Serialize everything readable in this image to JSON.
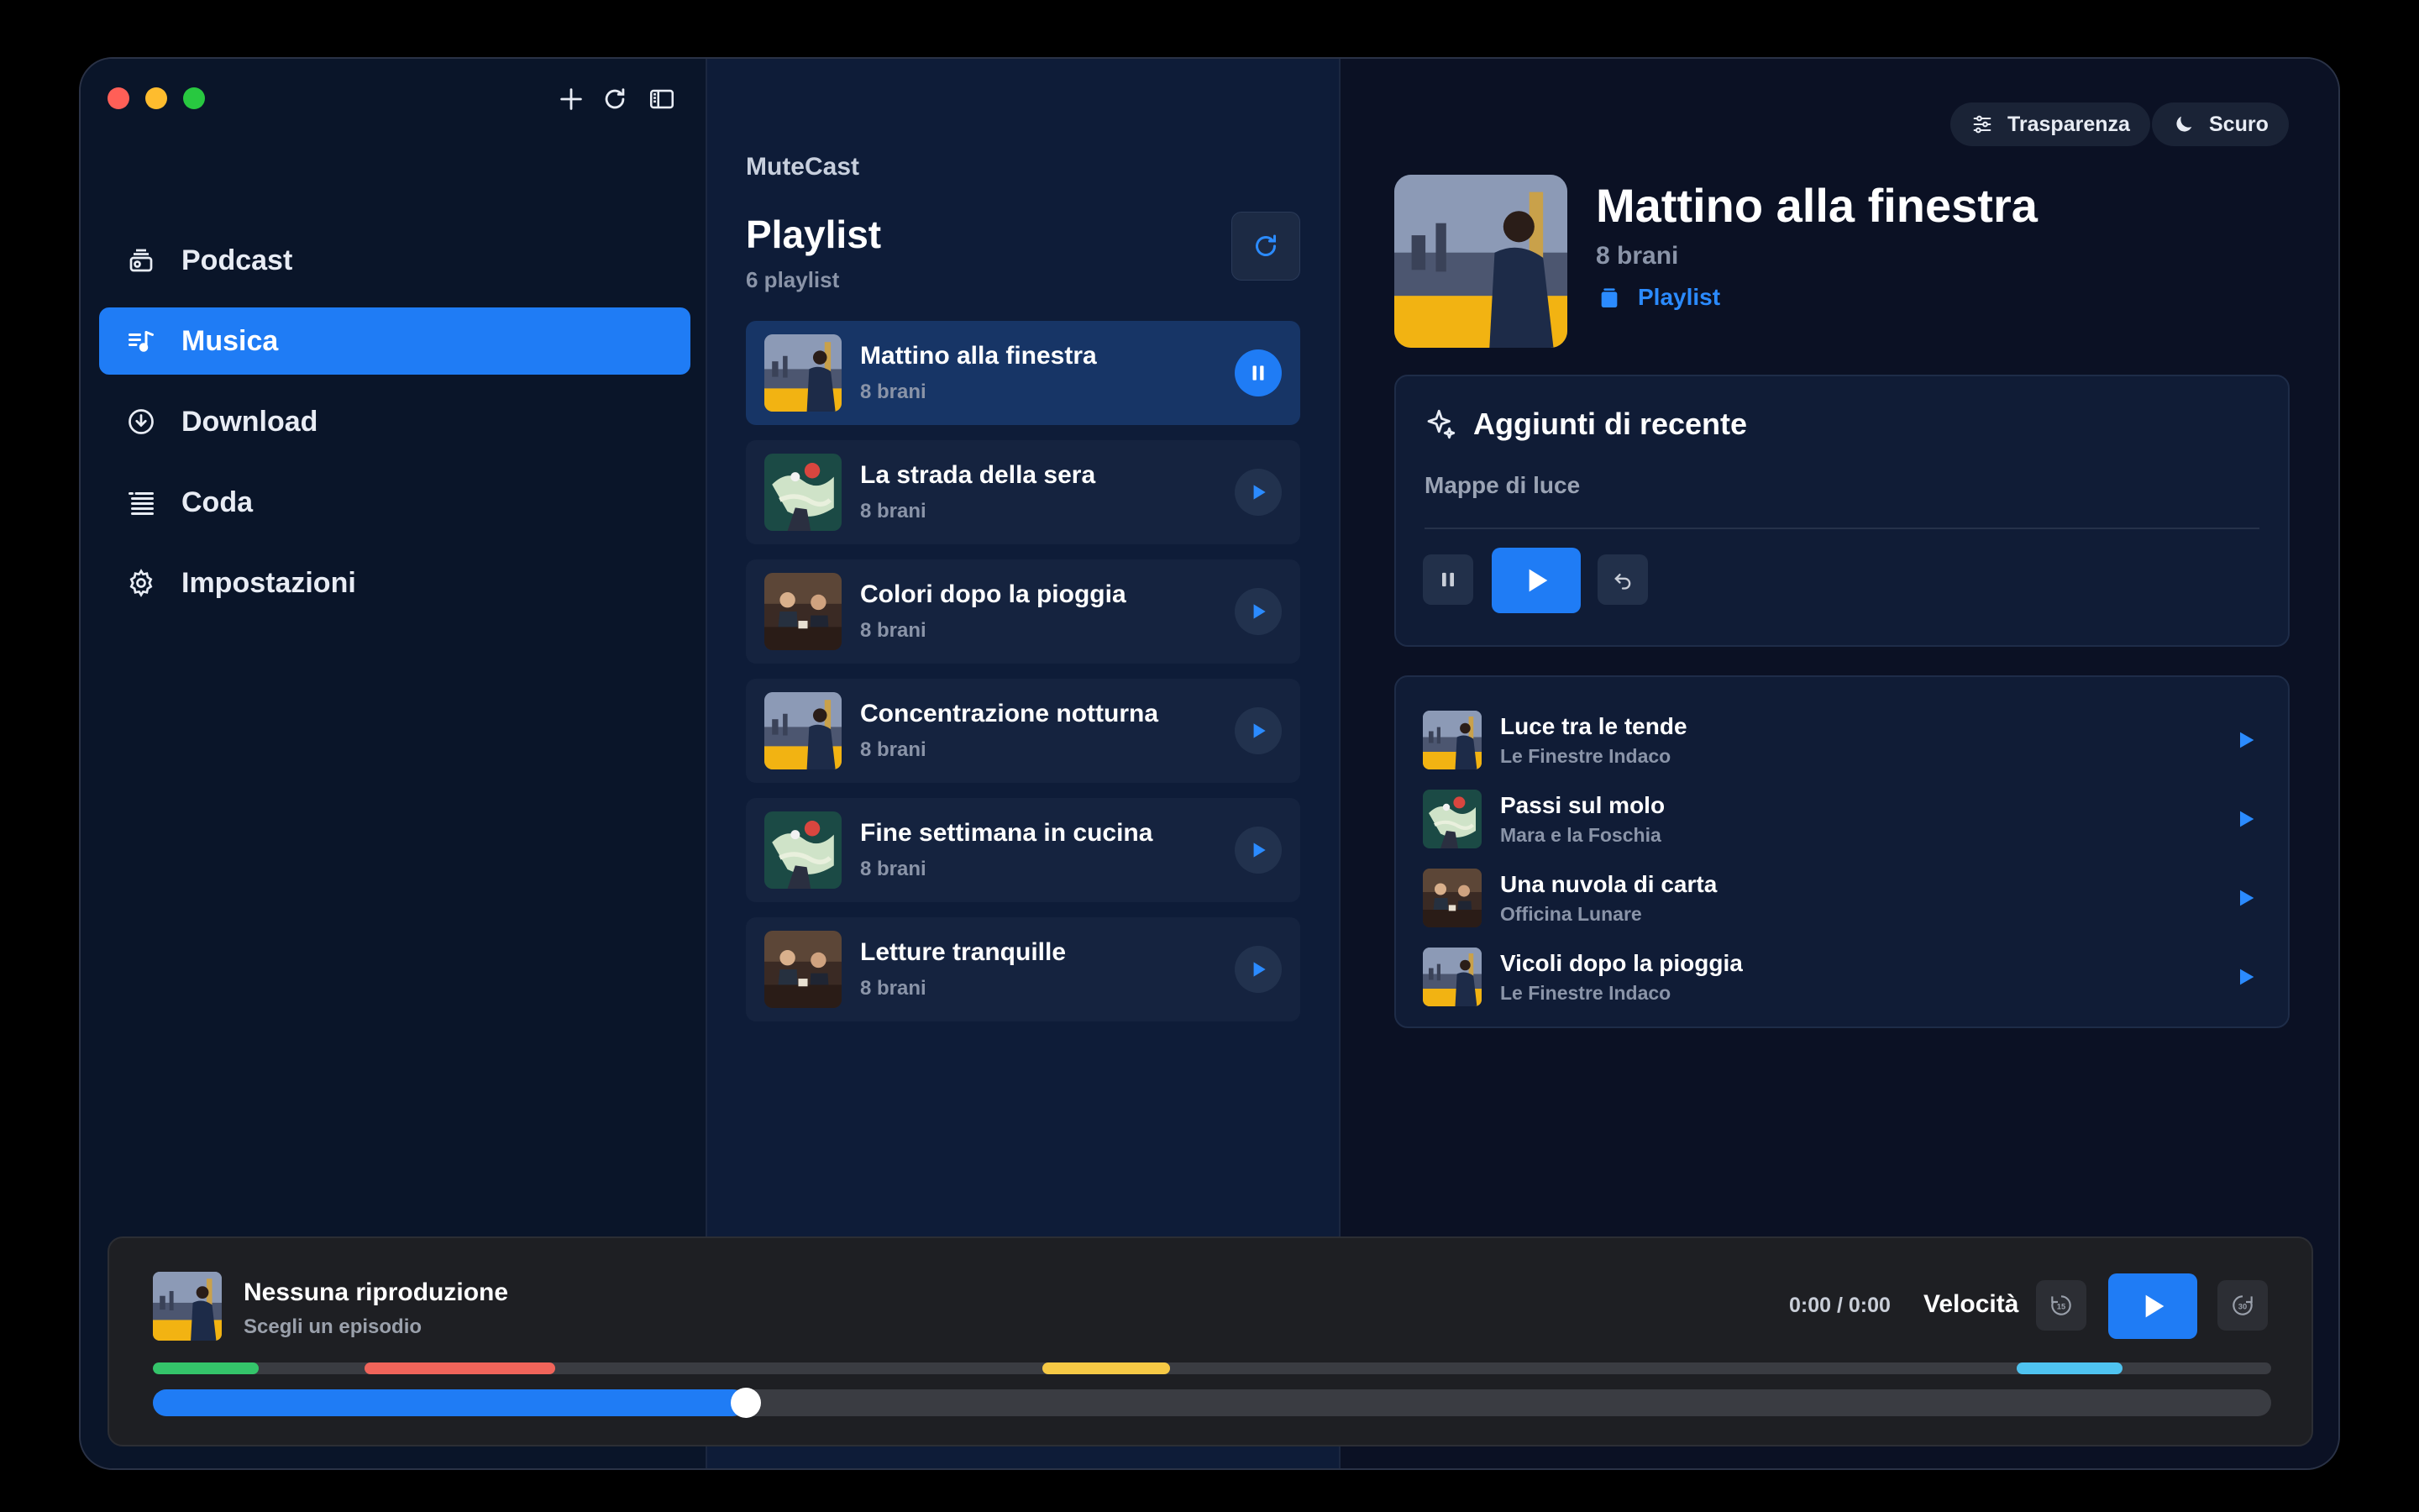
{
  "window": {
    "toolbar": {
      "new_icon": "plus-icon",
      "refresh_icon": "refresh-icon",
      "sidebar_icon": "sidebar-toggle-icon"
    }
  },
  "sidebar": {
    "items": [
      {
        "label": "Podcast",
        "icon": "podcast-icon",
        "active": false
      },
      {
        "label": "Musica",
        "icon": "music-icon",
        "active": true
      },
      {
        "label": "Download",
        "icon": "download-icon",
        "active": false
      },
      {
        "label": "Coda",
        "icon": "queue-icon",
        "active": false
      },
      {
        "label": "Impostazioni",
        "icon": "gear-icon",
        "active": false
      }
    ]
  },
  "list": {
    "brand": "MuteCast",
    "title": "Playlist",
    "count": "6 playlist",
    "playlists": [
      {
        "name": "Mattino alla finestra",
        "sub": "8 brani",
        "active": true
      },
      {
        "name": "La strada della sera",
        "sub": "8 brani",
        "active": false
      },
      {
        "name": "Colori dopo la pioggia",
        "sub": "8 brani",
        "active": false
      },
      {
        "name": "Concentrazione notturna",
        "sub": "8 brani",
        "active": false
      },
      {
        "name": "Fine settimana in cucina",
        "sub": "8 brani",
        "active": false
      },
      {
        "name": "Letture tranquille",
        "sub": "8 brani",
        "active": false
      }
    ]
  },
  "detail": {
    "transparency_label": "Trasparenza",
    "theme_label": "Scuro",
    "title": "Mattino alla finestra",
    "count": "8 brani",
    "type": "Playlist",
    "recent": {
      "heading": "Aggiunti di recente",
      "subtitle": "Mappe di luce"
    },
    "tracks": [
      {
        "name": "Luce tra le tende",
        "artist": "Le Finestre Indaco"
      },
      {
        "name": "Passi sul molo",
        "artist": "Mara e la Foschia"
      },
      {
        "name": "Una nuvola di carta",
        "artist": "Officina Lunare"
      },
      {
        "name": "Vicoli dopo la pioggia",
        "artist": "Le Finestre Indaco"
      }
    ]
  },
  "player": {
    "title": "Nessuna riproduzione",
    "subtitle": "Scegli un episodio",
    "time": "0:00 / 0:00",
    "speed_label": "Velocità",
    "skip_back": "15",
    "skip_forward": "30",
    "progress": 0.28,
    "chapters": [
      {
        "start": 0.0,
        "end": 0.05,
        "color": "#34c46a"
      },
      {
        "start": 0.1,
        "end": 0.19,
        "color": "#f0645a"
      },
      {
        "start": 0.42,
        "end": 0.48,
        "color": "#f6c945"
      },
      {
        "start": 0.88,
        "end": 0.93,
        "color": "#4fc3f0"
      }
    ]
  },
  "colors": {
    "accent": "#1f7cf5",
    "background": "#0c1428"
  }
}
